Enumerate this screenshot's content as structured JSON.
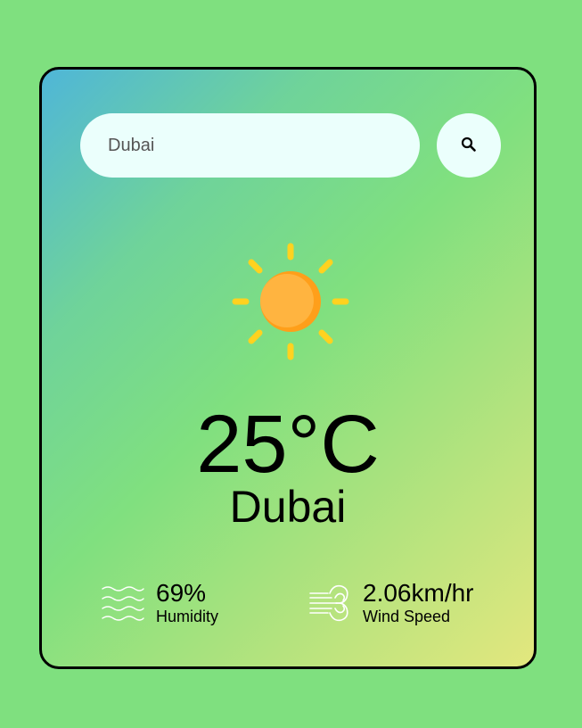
{
  "search": {
    "value": "Dubai",
    "button_icon": "search-icon"
  },
  "weather": {
    "icon": "sun-icon",
    "temperature": "25°C",
    "city": "Dubai"
  },
  "details": {
    "humidity": {
      "icon": "humidity-waves-icon",
      "value": "69%",
      "label": "Humidity"
    },
    "wind": {
      "icon": "wind-icon",
      "value": "2.06km/hr",
      "label": "Wind Speed"
    }
  },
  "colors": {
    "page_background": "#7fe07f",
    "card_gradient_start": "#4fb6d8",
    "card_gradient_end": "#e3e77e",
    "input_background": "#ebfffc",
    "sun_color": "#ffae3f",
    "sun_ray_color": "#ffd21f"
  }
}
